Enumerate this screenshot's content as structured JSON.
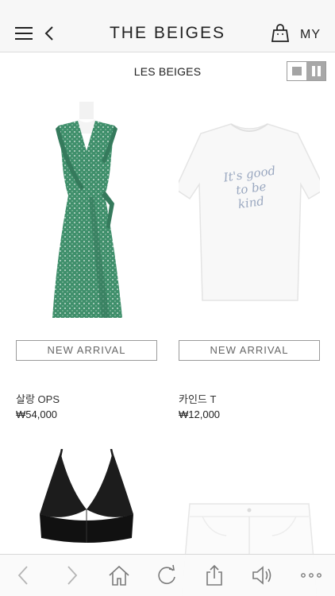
{
  "header": {
    "brand": "THE BEIGES",
    "my_label": "MY"
  },
  "section": {
    "title": "LES BEIGES"
  },
  "products": [
    {
      "badge": "NEW ARRIVAL",
      "name": "살랑 OPS",
      "price": "₩54,000",
      "image": "green-wrap-dress"
    },
    {
      "badge": "NEW ARRIVAL",
      "name": "카인드 T",
      "price": "₩12,000",
      "image": "white-tshirt",
      "print_text": [
        "It's good",
        "to be",
        "kind"
      ]
    },
    {
      "image": "black-bralette"
    },
    {
      "image": "white-shorts"
    }
  ],
  "toolbar": {
    "buttons": [
      "back-arrow-icon",
      "forward-arrow-icon",
      "home-icon",
      "refresh-icon",
      "share-icon",
      "speaker-icon",
      "more-dots-icon"
    ]
  },
  "colors": {
    "header_bg": "#f7f7f7",
    "dress": "#3f8f6b",
    "bralette": "#1c1c1c",
    "toggle_active": "#a8a8a8"
  }
}
